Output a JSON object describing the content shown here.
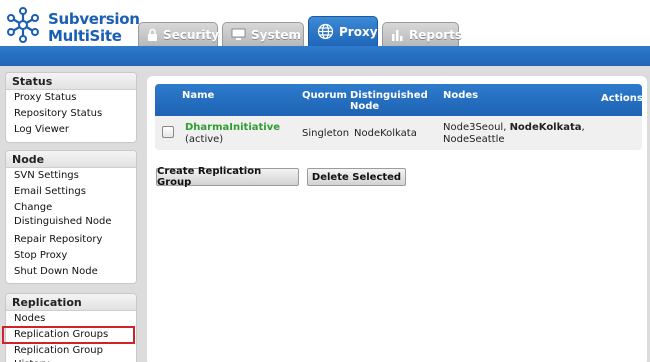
{
  "app": {
    "logo_line1": "Subversion",
    "logo_line2": "MultiSite",
    "brand_color": "#1a5fb4"
  },
  "tabs": [
    {
      "label": "Security",
      "icon": "lock-icon",
      "active": false
    },
    {
      "label": "System",
      "icon": "monitor-icon",
      "active": false
    },
    {
      "label": "Proxy",
      "icon": "globe-icon",
      "active": true
    },
    {
      "label": "Reports",
      "icon": "bar-chart-icon",
      "active": false
    }
  ],
  "sidebar": {
    "status": {
      "title": "Status",
      "items": [
        "Proxy Status",
        "Repository Status",
        "Log Viewer"
      ]
    },
    "node": {
      "title": "Node",
      "items": [
        "SVN Settings",
        "Email Settings",
        "Change Distinguished Node",
        "Repair Repository",
        "Stop Proxy",
        "Shut Down Node"
      ]
    },
    "replication": {
      "title": "Replication",
      "items": [
        "Nodes",
        "Replication Groups",
        "Replication Group History"
      ],
      "selected": "Replication Groups"
    }
  },
  "table": {
    "headers": {
      "name": "Name",
      "quorum": "Quorum",
      "dn": "Distinguished Node",
      "nodes": "Nodes",
      "actions": "Actions"
    },
    "rows": [
      {
        "name": "DharmaInitiative",
        "status": "(active)",
        "quorum": "Singleton",
        "distinguished_node": "NodeKolkata",
        "nodes_pre": "Node3Seoul, ",
        "nodes_bold": "NodeKolkata",
        "nodes_post": ",",
        "nodes_line2": "NodeSeattle"
      }
    ]
  },
  "buttons": {
    "create": "Create Replication Group",
    "delete": "Delete Selected"
  },
  "colors": {
    "accent": "#1f66b8",
    "group_name": "#2f9d2f",
    "selection_outline": "#d3212c"
  }
}
